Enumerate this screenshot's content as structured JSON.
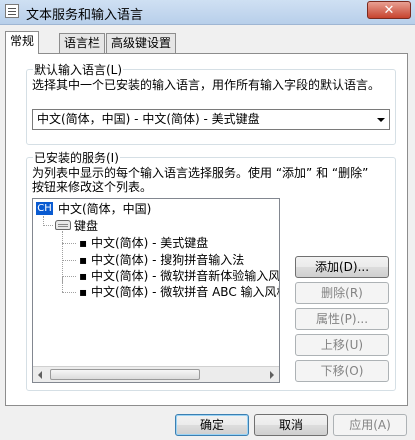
{
  "window": {
    "title": "文本服务和输入语言",
    "close_label": "✕"
  },
  "tabs": [
    {
      "label": "常规",
      "active": true
    },
    {
      "label": "语言栏",
      "active": false
    },
    {
      "label": "高级键设置",
      "active": false
    }
  ],
  "default_language": {
    "legend": "默认输入语言(L)",
    "description": "选择其中一个已安装的输入语言，用作所有输入字段的默认语言。",
    "selected": "中文(简体，中国) - 中文(简体) - 美式键盘"
  },
  "installed_services": {
    "legend": "已安装的服务(I)",
    "description_line1": "为列表中显示的每个输入语言选择服务。使用 “添加” 和 “删除”",
    "description_line2": "按钮来修改这个列表。",
    "tree": {
      "language": "中文(简体，中国)",
      "language_badge": "CH",
      "category": "键盘",
      "items": [
        "中文(简体) - 美式键盘",
        "中文(简体) - 搜狗拼音输入法",
        "中文(简体) - 微软拼音新体验输入风格",
        "中文(简体) - 微软拼音 ABC 输入风格"
      ]
    },
    "buttons": {
      "add": "添加(D)...",
      "remove": "删除(R)",
      "properties": "属性(P)...",
      "move_up": "上移(U)",
      "move_down": "下移(O)"
    }
  },
  "footer": {
    "ok": "确定",
    "cancel": "取消",
    "apply": "应用(A)"
  }
}
